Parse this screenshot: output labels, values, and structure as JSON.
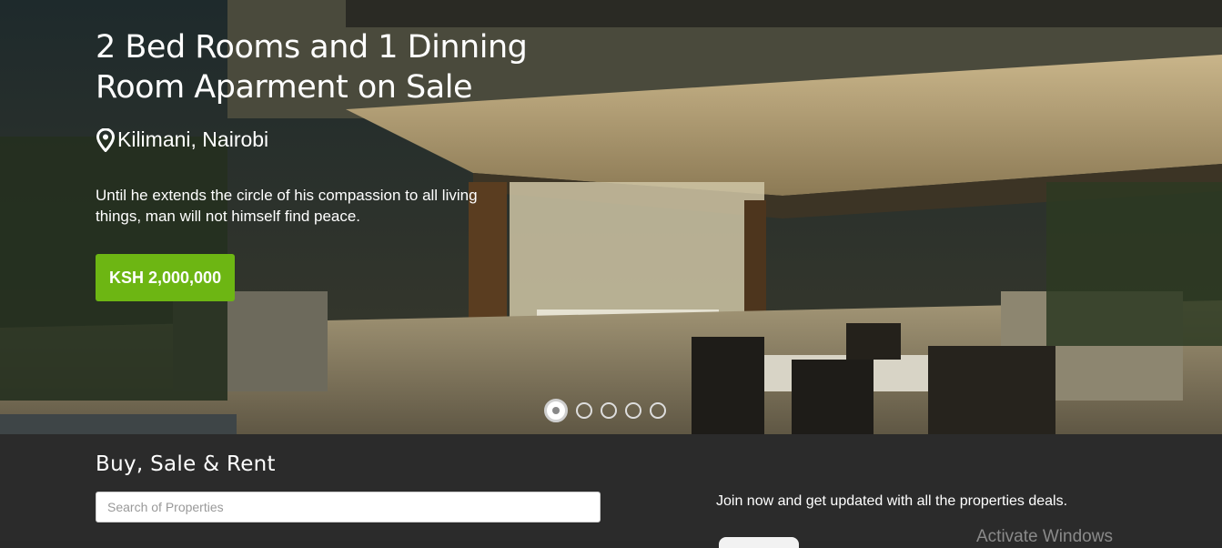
{
  "hero": {
    "title": "2 Bed Rooms and 1 Dinning Room Aparment on Sale",
    "location": "Kilimani, Nairobi",
    "location_icon": "map-pin-icon",
    "description": "Until he extends the circle of his compassion to all living things, man will not himself find peace.",
    "price": "KSH 2,000,000",
    "slides_total": 5,
    "slide_active_index": 0,
    "colors": {
      "price_button": "#6db613",
      "text": "#ffffff"
    }
  },
  "bottom": {
    "section_title": "Buy, Sale & Rent",
    "search_placeholder": "Search of Properties",
    "search_value": "",
    "join_text": "Join now and get updated with all the properties deals.",
    "watermark": "Activate Windows"
  }
}
